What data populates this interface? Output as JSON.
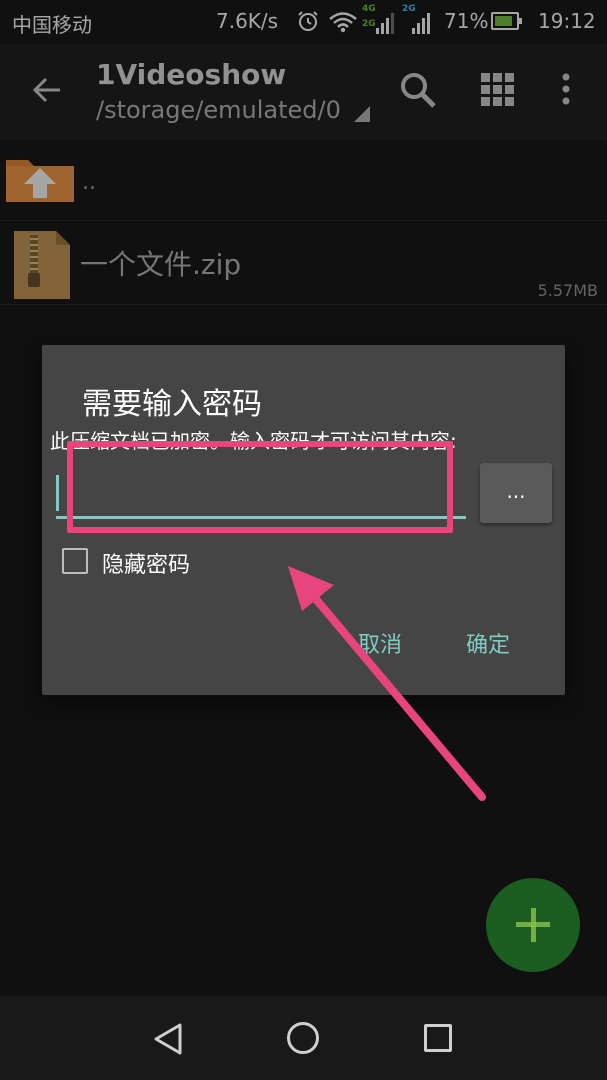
{
  "status_bar": {
    "carrier": "中国移动",
    "net_speed": "7.6K/s",
    "net_4g_top": "4G",
    "net_4g_bottom": "2G",
    "net_2g": "2G",
    "battery_percent": "71%",
    "battery_level": 0.71,
    "time": "19:12"
  },
  "app_bar": {
    "title": "1Videoshow",
    "path": "/storage/emulated/0"
  },
  "files": [
    {
      "name": "..",
      "type": "parent",
      "icon": "folder-up-icon"
    },
    {
      "name": "一个文件.zip",
      "type": "zip",
      "size": "5.57MB",
      "icon": "zip-file-icon"
    }
  ],
  "dialog": {
    "title": "需要输入密码",
    "message": "此压缩文档已加密。输入密码才可访问其内容:",
    "password_value": "",
    "browse_label": "...",
    "hide_password_label": "隐藏密码",
    "hide_password_checked": false,
    "cancel_label": "取消",
    "ok_label": "确定"
  },
  "colors": {
    "accent": "#80cbc4",
    "annotation": "#e8457f",
    "fab": "#1b5e20"
  }
}
